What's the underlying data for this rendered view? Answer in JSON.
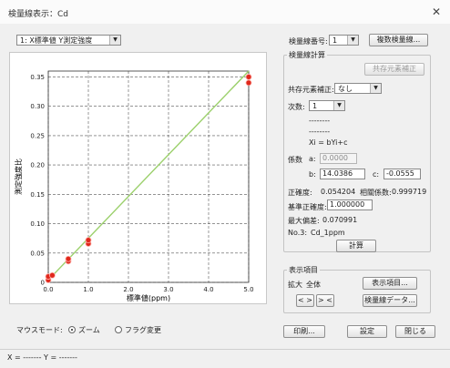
{
  "window": {
    "title": "検量線表示：Cd",
    "close_glyph": "✕"
  },
  "plot_selector": {
    "value": "1: X標準値 Y測定強度"
  },
  "curve_no": {
    "label": "検量線番号:",
    "value": "1"
  },
  "multi_curve_button": "複数検量線...",
  "calc_group": {
    "caption": "検量線計算",
    "coexist_button": "共存元素補正",
    "coexist_label": "共存元素補正:",
    "coexist_value": "なし",
    "order_label": "次数:",
    "order_value": "1",
    "dash1": "--------",
    "dash2": "--------",
    "formula": "Xi = bYi+c",
    "coef_label": "係数",
    "a_label": "a:",
    "a_value": "0.0000",
    "b_label": "b:",
    "b_value": "14.0386",
    "c_label": "c:",
    "c_value": "-0.0555",
    "accuracy_label": "正確度:",
    "accuracy_value": "0.054204",
    "corr_label": "相關係数:",
    "corr_value": "0.999719",
    "ref_acc_label": "基準正確度:",
    "ref_acc_value": "1.000000",
    "max_dev_label": "最大偏差:",
    "max_dev_value": "0.070991",
    "no_label": "No.3:",
    "no_value": "Cd_1ppm",
    "calc_button": "計算"
  },
  "display_group": {
    "caption": "表示項目",
    "zoom_label": "拡大",
    "zoom_value": "全体",
    "items_button": "表示項目...",
    "prev_next_button": "< >",
    "swap_button": "> <",
    "curve_data_button": "検量線データ..."
  },
  "mouse_mode": {
    "label": "マウスモード:",
    "zoom": "ズーム",
    "flag": "フラグ変更"
  },
  "footer_buttons": {
    "print": "印刷...",
    "settings": "設定",
    "close": "閉じる"
  },
  "status": {
    "text": "X = -------  Y = -------"
  },
  "colors": {
    "line": "#9bd06b",
    "point": "#e0281c",
    "grid": "#555555"
  },
  "chart_data": {
    "type": "scatter",
    "xlabel": "標準値(ppm)",
    "ylabel": "測定強度比",
    "xlim": [
      0,
      5.0
    ],
    "ylim": [
      0,
      0.36
    ],
    "x_ticks": [
      "0.0",
      "1.0",
      "2.0",
      "3.0",
      "4.0",
      "5.0"
    ],
    "y_ticks": [
      "0",
      "0.05",
      "0.10",
      "0.15",
      "0.20",
      "0.25",
      "0.30",
      "0.35"
    ],
    "grid": true,
    "series": [
      {
        "points": [
          [
            0.0,
            0.004
          ],
          [
            0.0,
            0.01
          ],
          [
            0.1,
            0.012
          ],
          [
            0.5,
            0.036
          ],
          [
            0.5,
            0.04
          ],
          [
            1.0,
            0.066
          ],
          [
            1.0,
            0.072
          ],
          [
            5.0,
            0.34
          ],
          [
            5.0,
            0.35
          ]
        ]
      }
    ],
    "fit_line": [
      [
        0.0,
        0.004
      ],
      [
        5.0,
        0.36
      ]
    ]
  }
}
